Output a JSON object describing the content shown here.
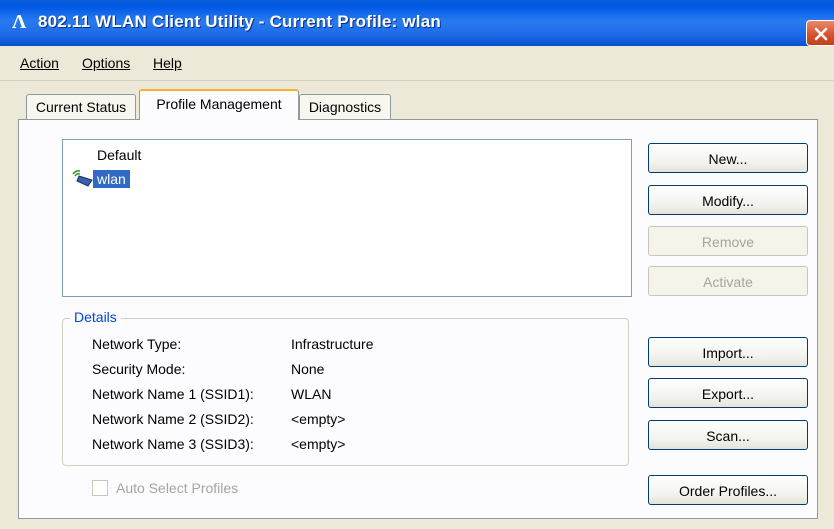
{
  "window": {
    "title": "802.11 WLAN Client Utility - Current Profile: wlan",
    "app_icon_glyph": "Λ",
    "close_icon": "close-icon"
  },
  "menu": {
    "items": [
      {
        "label": "Action"
      },
      {
        "label": "Options"
      },
      {
        "label": "Help"
      }
    ]
  },
  "tabs": [
    {
      "label": "Current Status"
    },
    {
      "label": "Profile Management",
      "active": true
    },
    {
      "label": "Diagnostics"
    }
  ],
  "profiles": {
    "items": [
      {
        "label": "Default",
        "selected": false
      },
      {
        "label": "wlan",
        "selected": true,
        "icon": "wireless-profile-icon"
      }
    ]
  },
  "buttons": {
    "new": "New...",
    "modify": "Modify...",
    "remove": "Remove",
    "activate": "Activate",
    "import": "Import...",
    "export": "Export...",
    "scan": "Scan...",
    "order_profiles": "Order Profiles..."
  },
  "details": {
    "legend": "Details",
    "rows": [
      {
        "label": "Network Type:",
        "value": "Infrastructure"
      },
      {
        "label": "Security Mode:",
        "value": "None"
      },
      {
        "label": "Network Name 1 (SSID1):",
        "value": "WLAN"
      },
      {
        "label": "Network Name 2 (SSID2):",
        "value": "<empty>"
      },
      {
        "label": "Network Name 3 (SSID3):",
        "value": "<empty>"
      }
    ]
  },
  "auto_select": {
    "label": "Auto Select Profiles",
    "checked": false,
    "enabled": false
  },
  "colors": {
    "titlebar": "#1e6ae6",
    "selection": "#316ac5",
    "legend": "#0046d5",
    "close": "#d4502a"
  }
}
